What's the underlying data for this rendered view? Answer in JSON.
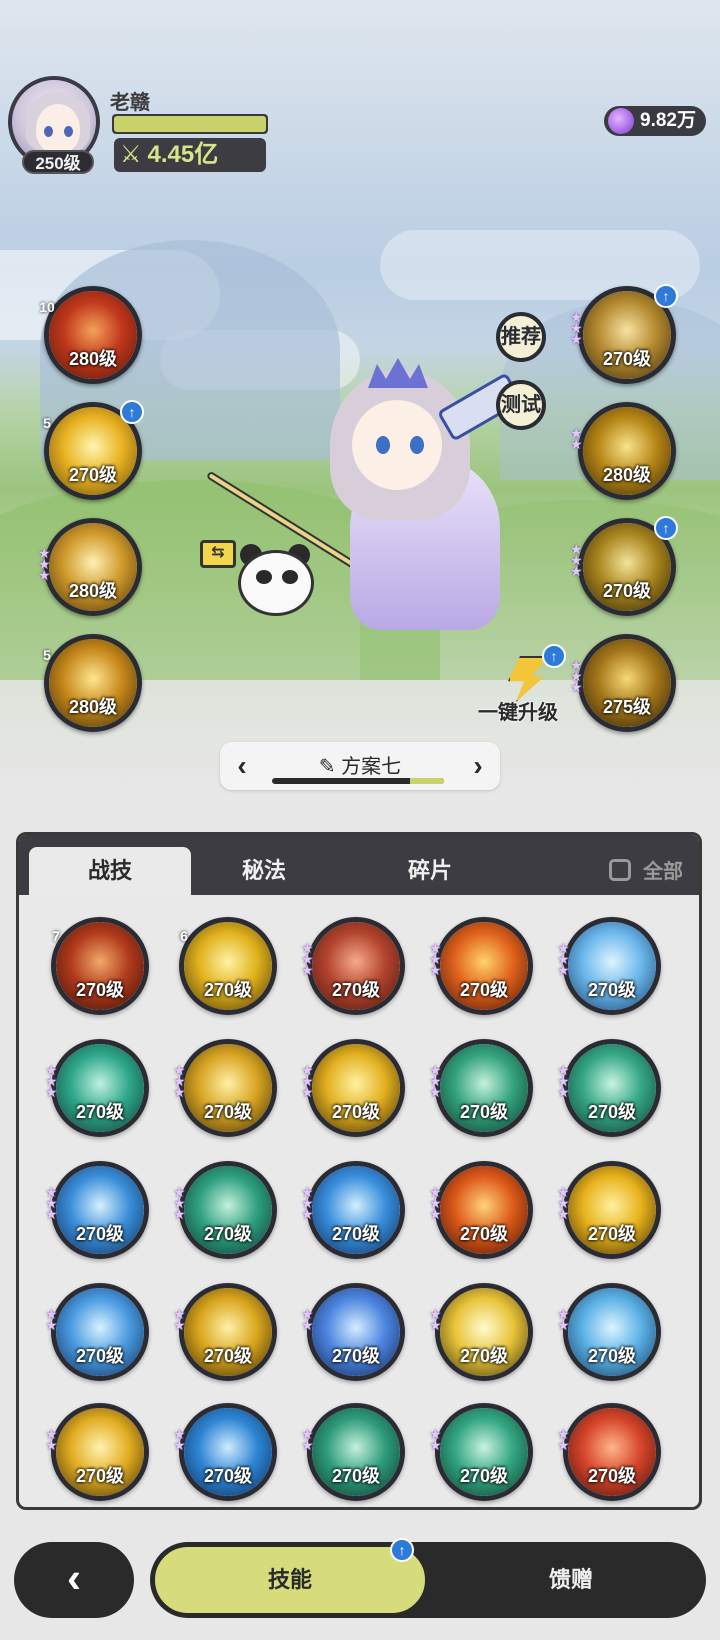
{
  "player": {
    "name": "老赣",
    "level_label": "250级",
    "xp_fraction": 1.0,
    "power": "4.45亿"
  },
  "currency": {
    "value": "9.82万",
    "icon": "purple-gem-icon"
  },
  "side_buttons": {
    "recommend": "推荐",
    "test": "测试"
  },
  "one_key_upgrade": "一键升级",
  "left_skills": [
    {
      "level": "280级",
      "badge": "10",
      "badge_type": "silver",
      "upgrade": false,
      "colors": [
        "#f3a25a",
        "#c0371c",
        "#5a1606"
      ]
    },
    {
      "level": "270级",
      "badge": "5",
      "badge_type": "gold",
      "upgrade": true,
      "colors": [
        "#fff5b0",
        "#e9b322",
        "#6a4a0c"
      ]
    },
    {
      "level": "280级",
      "badge": "",
      "badge_type": "stars3",
      "upgrade": false,
      "colors": [
        "#fff0b3",
        "#d09a2c",
        "#4e3208"
      ]
    },
    {
      "level": "280级",
      "badge": "5",
      "badge_type": "lilac",
      "upgrade": false,
      "colors": [
        "#ffe690",
        "#c7891b",
        "#3d2a06"
      ]
    }
  ],
  "right_skills": [
    {
      "level": "270级",
      "badge_type": "stars3",
      "upgrade": true,
      "colors": [
        "#f6e2a2",
        "#b58a30",
        "#3d2c0d"
      ]
    },
    {
      "level": "280级",
      "badge_type": "stars2",
      "upgrade": false,
      "colors": [
        "#f8e38c",
        "#b68616",
        "#3a2805"
      ]
    },
    {
      "level": "270级",
      "badge_type": "stars3",
      "upgrade": true,
      "colors": [
        "#f4e39a",
        "#a9851e",
        "#2f2406"
      ]
    },
    {
      "level": "275级",
      "badge_type": "stars3",
      "upgrade": false,
      "colors": [
        "#f7d877",
        "#a4761a",
        "#2c1f05"
      ]
    }
  ],
  "plan": {
    "name": "方案七",
    "edit_icon": "pencil-icon",
    "progress": 0.2
  },
  "tabs": [
    {
      "label": "战技",
      "active": true
    },
    {
      "label": "秘法",
      "active": false
    },
    {
      "label": "碎片",
      "active": false
    }
  ],
  "select_all_label": "全部",
  "grid_skills": [
    {
      "level": "270级",
      "badge": "7",
      "colors": [
        "#f2a869",
        "#b03a1c",
        "#3a0e06"
      ]
    },
    {
      "level": "270级",
      "badge": "6",
      "colors": [
        "#fff3a6",
        "#e0b21c",
        "#4a3406"
      ]
    },
    {
      "level": "270级",
      "badge": "",
      "colors": [
        "#f7a98a",
        "#b3442e",
        "#4a140c"
      ]
    },
    {
      "level": "270级",
      "badge": "",
      "colors": [
        "#ffd36b",
        "#e0621c",
        "#4a1506"
      ]
    },
    {
      "level": "270级",
      "badge": "",
      "colors": [
        "#dff3ff",
        "#6cb8ec",
        "#16406e"
      ]
    },
    {
      "level": "270级",
      "badge": "",
      "colors": [
        "#bff1df",
        "#2fa78a",
        "#0c3b32"
      ]
    },
    {
      "level": "270级",
      "badge": "",
      "colors": [
        "#fff0a6",
        "#d8a522",
        "#3f2c05"
      ]
    },
    {
      "level": "270级",
      "badge": "",
      "colors": [
        "#fff2a2",
        "#e2b020",
        "#3d2904"
      ]
    },
    {
      "level": "270级",
      "badge": "",
      "colors": [
        "#c5f2dc",
        "#34a37e",
        "#0b3a2c"
      ]
    },
    {
      "level": "270级",
      "badge": "",
      "colors": [
        "#c8f4e0",
        "#36a886",
        "#0d3b30"
      ]
    },
    {
      "level": "270级",
      "badge": "",
      "colors": [
        "#d6f0ff",
        "#3b8fd9",
        "#0c2d5c"
      ]
    },
    {
      "level": "270级",
      "badge": "",
      "colors": [
        "#c5f1dd",
        "#2ea080",
        "#0b382d"
      ]
    },
    {
      "level": "270级",
      "badge": "",
      "colors": [
        "#d2eeff",
        "#3a8fdc",
        "#0b2c5d"
      ]
    },
    {
      "level": "270级",
      "badge": "",
      "colors": [
        "#ffd27a",
        "#dd5a1a",
        "#431104"
      ]
    },
    {
      "level": "270级",
      "badge": "",
      "colors": [
        "#fff0a0",
        "#e7b31c",
        "#3f2904"
      ]
    },
    {
      "level": "270级",
      "badge": "",
      "colors": [
        "#d7f1ff",
        "#4a9be0",
        "#0c2c59"
      ]
    },
    {
      "level": "270级",
      "badge": "",
      "colors": [
        "#fff0a8",
        "#d9a61d",
        "#3a2703"
      ]
    },
    {
      "level": "270级",
      "badge": "",
      "colors": [
        "#d4ecff",
        "#4d86e0",
        "#0f2458"
      ]
    },
    {
      "level": "270级",
      "badge": "",
      "colors": [
        "#fffbd0",
        "#e8c43a",
        "#3f3205"
      ]
    },
    {
      "level": "270级",
      "badge": "",
      "colors": [
        "#dcf4ff",
        "#5db2e6",
        "#0f3a60"
      ]
    },
    {
      "level": "270级",
      "badge": "",
      "colors": [
        "#fff3b0",
        "#e2ad22",
        "#3d2a05"
      ]
    },
    {
      "level": "270级",
      "badge": "",
      "colors": [
        "#cfeaff",
        "#2e86d4",
        "#0a2a57"
      ]
    },
    {
      "level": "270级",
      "badge": "",
      "colors": [
        "#c6f1dd",
        "#2e9c7b",
        "#0a362b"
      ]
    },
    {
      "level": "270级",
      "badge": "",
      "colors": [
        "#c9f3df",
        "#33a682",
        "#0b3a2d"
      ]
    },
    {
      "level": "270级",
      "badge": "",
      "colors": [
        "#ffb58a",
        "#d6452a",
        "#45100a"
      ]
    }
  ],
  "nav": {
    "back": "back-arrow-icon",
    "skill": "技能",
    "gift": "馈赠"
  },
  "accent": "#d6dc7b"
}
